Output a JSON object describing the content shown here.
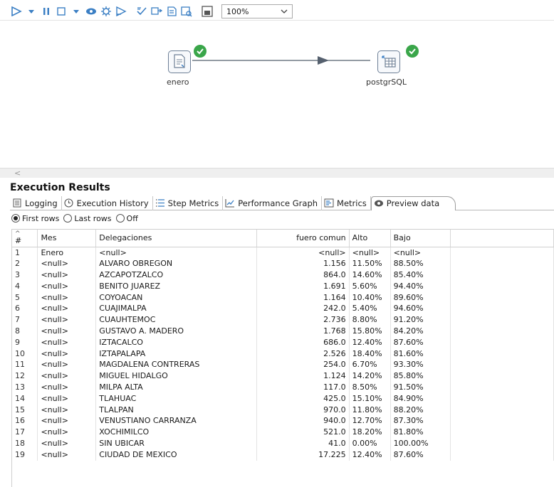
{
  "toolbar": {
    "icons": [
      "run-icon",
      "dropdown-arrow-icon",
      "pause-icon",
      "stop-icon",
      "dropdown-arrow-icon",
      "preview-icon",
      "debug-icon",
      "replay-icon",
      "verify-icon",
      "impact-icon",
      "sql-icon",
      "explore-db-icon",
      "show-results-icon"
    ],
    "zoom": "100%"
  },
  "canvas": {
    "steps": [
      {
        "name": "enero",
        "icon": "text-file-input-icon",
        "status": "success"
      },
      {
        "name": "postgrSQL",
        "icon": "table-output-icon",
        "status": "success"
      }
    ]
  },
  "results": {
    "title": "Execution Results",
    "tabs": [
      {
        "label": "Logging",
        "icon": "logging-icon"
      },
      {
        "label": "Execution History",
        "icon": "history-icon"
      },
      {
        "label": "Step Metrics",
        "icon": "step-metrics-icon"
      },
      {
        "label": "Performance Graph",
        "icon": "performance-graph-icon"
      },
      {
        "label": "Metrics",
        "icon": "metrics-icon"
      },
      {
        "label": "Preview data",
        "icon": "preview-eye-icon",
        "active": true
      }
    ],
    "radios": [
      {
        "label": "First rows",
        "selected": true
      },
      {
        "label": "Last rows",
        "selected": false
      },
      {
        "label": "Off",
        "selected": false
      }
    ],
    "columns": [
      "#",
      "Mes",
      "Delegaciones",
      "fuero comun",
      "Alto",
      "Bajo"
    ],
    "rows": [
      [
        "1",
        "Enero",
        "<null>",
        "<null>",
        "<null>",
        "<null>"
      ],
      [
        "2",
        "<null>",
        "ALVARO OBREGON",
        "1.156",
        "11.50%",
        "88.50%"
      ],
      [
        "3",
        "<null>",
        "AZCAPOTZALCO",
        "864.0",
        "14.60%",
        "85.40%"
      ],
      [
        "4",
        "<null>",
        "BENITO JUAREZ",
        "1.691",
        "5.60%",
        "94.40%"
      ],
      [
        "5",
        "<null>",
        "COYOACAN",
        "1.164",
        "10.40%",
        "89.60%"
      ],
      [
        "6",
        "<null>",
        "CUAJIMALPA",
        "242.0",
        "5.40%",
        "94.60%"
      ],
      [
        "7",
        "<null>",
        "CUAUHTEMOC",
        "2.736",
        "8.80%",
        "91.20%"
      ],
      [
        "8",
        "<null>",
        "GUSTAVO A. MADERO",
        "1.768",
        "15.80%",
        "84.20%"
      ],
      [
        "9",
        "<null>",
        "IZTACALCO",
        "686.0",
        "12.40%",
        "87.60%"
      ],
      [
        "10",
        "<null>",
        "IZTAPALAPA",
        "2.526",
        "18.40%",
        "81.60%"
      ],
      [
        "11",
        "<null>",
        "MAGDALENA CONTRERAS",
        "254.0",
        "6.70%",
        "93.30%"
      ],
      [
        "12",
        "<null>",
        "MIGUEL HIDALGO",
        "1.124",
        "14.20%",
        "85.80%"
      ],
      [
        "13",
        "<null>",
        "MILPA ALTA",
        "117.0",
        "8.50%",
        "91.50%"
      ],
      [
        "14",
        "<null>",
        "TLAHUAC",
        "425.0",
        "15.10%",
        "84.90%"
      ],
      [
        "15",
        "<null>",
        "TLALPAN",
        "970.0",
        "11.80%",
        "88.20%"
      ],
      [
        "16",
        "<null>",
        "VENUSTIANO CARRANZA",
        "940.0",
        "12.70%",
        "87.30%"
      ],
      [
        "17",
        "<null>",
        "XOCHIMILCO",
        "521.0",
        "18.20%",
        "81.80%"
      ],
      [
        "18",
        "<null>",
        "SIN UBICAR",
        "41.0",
        "0.00%",
        "100.00%"
      ],
      [
        "19",
        "<null>",
        "CIUDAD DE MEXICO",
        "17.225",
        "12.40%",
        "87.60%"
      ]
    ]
  },
  "colors": {
    "accent": "#3b7fc4",
    "success": "#3aa64a"
  }
}
